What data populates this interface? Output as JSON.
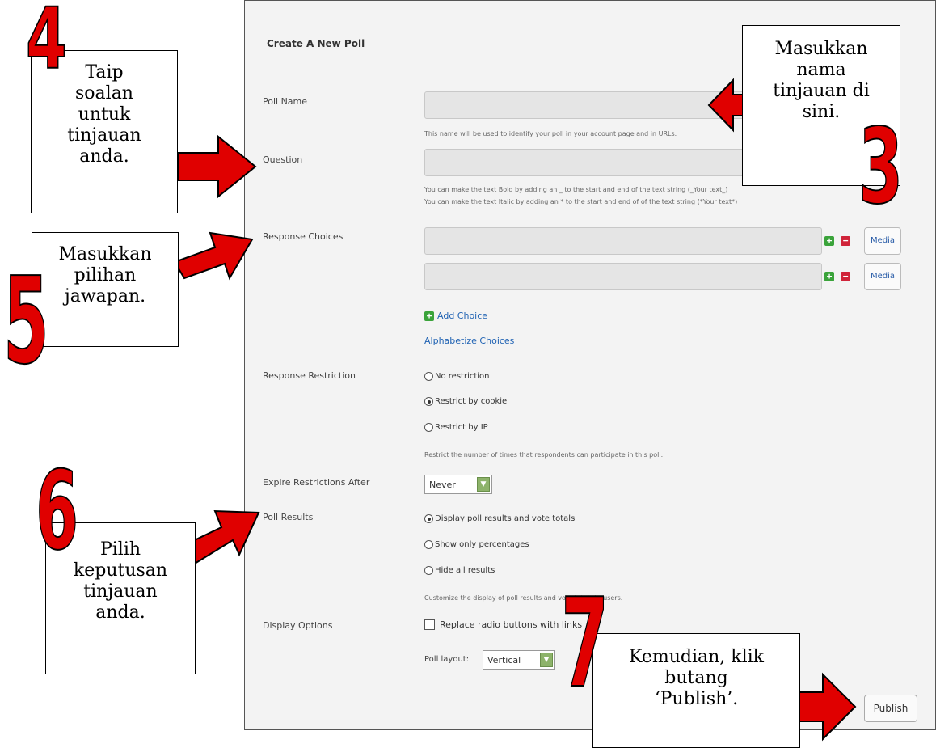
{
  "form": {
    "title": "Create A New Poll",
    "poll_name": {
      "label": "Poll Name",
      "value": "",
      "help": "This name will be used to identify your poll in your account page and in URLs."
    },
    "question": {
      "label": "Question",
      "value": "",
      "help_line1": "You can make the text Bold by adding an _ to the start and end of the text string (_Your text_)",
      "help_line2": "You can make the text Italic by adding an * to the start and end of of the text string (*Your text*)"
    },
    "response_choices": {
      "label": "Response Choices",
      "choices": [
        "",
        ""
      ],
      "media_label": "Media",
      "add_choice": "Add Choice",
      "alphabetize": "Alphabetize Choices"
    },
    "response_restriction": {
      "label": "Response Restriction",
      "options": [
        "No restriction",
        "Restrict by cookie",
        "Restrict by IP"
      ],
      "selected": "Restrict by cookie",
      "help": "Restrict the number of times that respondents can participate in this poll."
    },
    "expire": {
      "label": "Expire Restrictions After",
      "value": "Never"
    },
    "poll_results": {
      "label": "Poll Results",
      "options": [
        "Display poll results and vote totals",
        "Show only percentages",
        "Hide all results"
      ],
      "selected": "Display poll results and vote totals",
      "help": "Customize the display of poll results and vote totals to users."
    },
    "display_options": {
      "label": "Display Options",
      "checkbox_label": "Replace radio buttons with links",
      "checked": false,
      "layout_label": "Poll layout:",
      "layout_value": "Vertical"
    },
    "publish_label": "Publish"
  },
  "callouts": {
    "c3": {
      "number": "3",
      "lines": [
        "Masukkan",
        "nama",
        "tinjauan di",
        "sini."
      ]
    },
    "c4": {
      "number": "4",
      "lines": [
        "Taip",
        "soalan",
        "untuk",
        "tinjauan",
        "anda."
      ]
    },
    "c5": {
      "number": "5",
      "lines": [
        "Masukkan",
        "pilihan",
        "jawapan."
      ]
    },
    "c6": {
      "number": "6",
      "lines": [
        "Pilih",
        "keputusan",
        "tinjauan",
        "anda."
      ]
    },
    "c7": {
      "number": "7",
      "lines": [
        "Kemudian, klik",
        "butang",
        "‘Publish’."
      ]
    }
  },
  "colors": {
    "arrow_fill": "#e00000",
    "arrow_stroke": "#000000",
    "link": "#1f62b3"
  }
}
